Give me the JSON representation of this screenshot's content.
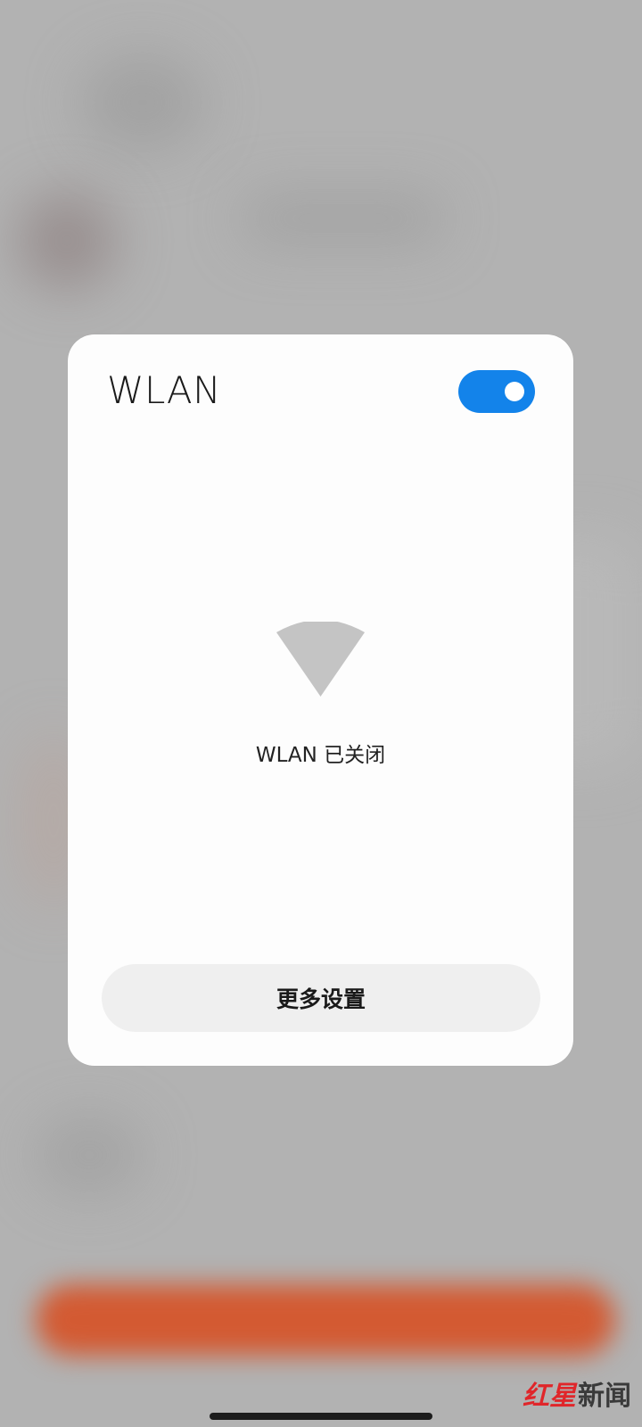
{
  "dialog": {
    "title": "WLAN",
    "toggle_on": true,
    "status_text": "WLAN 已关闭",
    "more_settings_label": "更多设置",
    "icon": "wifi-off-icon"
  },
  "watermark": {
    "brand_red": "红星",
    "brand_dark": "新闻"
  },
  "colors": {
    "accent": "#1383ea",
    "watermark_red": "#e0262a",
    "background_bar": "#d35a32"
  }
}
